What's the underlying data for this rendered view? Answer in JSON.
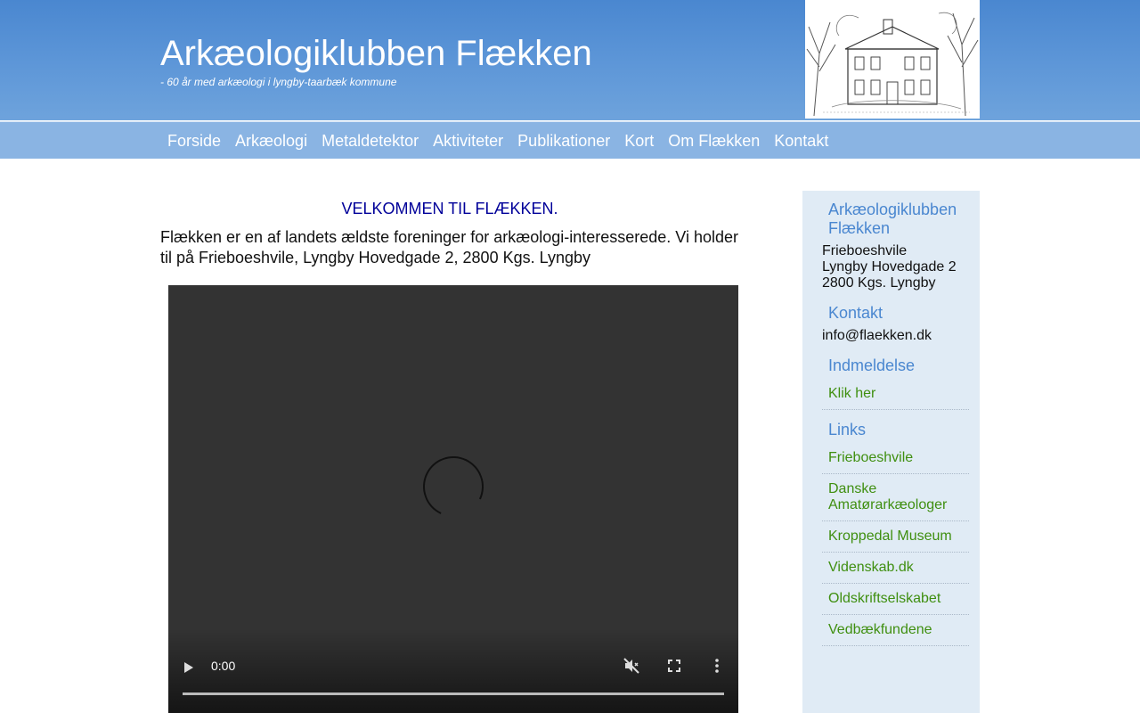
{
  "header": {
    "title": "Arkæologiklubben Flækken",
    "tagline": "- 60 år med arkæologi i lyngby-taarbæk kommune"
  },
  "nav": {
    "items": [
      "Forside",
      "Arkæologi",
      "Metaldetektor",
      "Aktiviteter",
      "Publikationer",
      "Kort",
      "Om Flækken",
      "Kontakt"
    ]
  },
  "main": {
    "welcome": "VELKOMMEN TIL FLÆKKEN.",
    "intro": "Flækken er en af landets ældste foreninger for arkæologi-interesserede. Vi holder til på Frieboeshvile, Lyngby Hovedgade 2, 2800 Kgs. Lyngby",
    "video": {
      "time": "0:00"
    }
  },
  "sidebar": {
    "club_heading": "Arkæologiklubben Flækken",
    "address": [
      "Frieboeshvile",
      "Lyngby Hovedgade 2",
      "2800 Kgs. Lyngby"
    ],
    "contact_heading": "Kontakt",
    "email": "info@flaekken.dk",
    "join_heading": "Indmeldelse",
    "join_link": "Klik her",
    "links_heading": "Links",
    "links": [
      "Frieboeshvile",
      "Danske Amatørarkæologer",
      "Kroppedal Museum",
      "Videnskab.dk",
      "Oldskriftselskabet",
      "Vedbækfundene"
    ]
  },
  "colors": {
    "header_blue": "#4a87d0",
    "nav_blue": "#8ab4e3",
    "welcome_navy": "#000099",
    "link_green": "#3f8f10",
    "sidebar_bg": "#e0ebf5"
  }
}
